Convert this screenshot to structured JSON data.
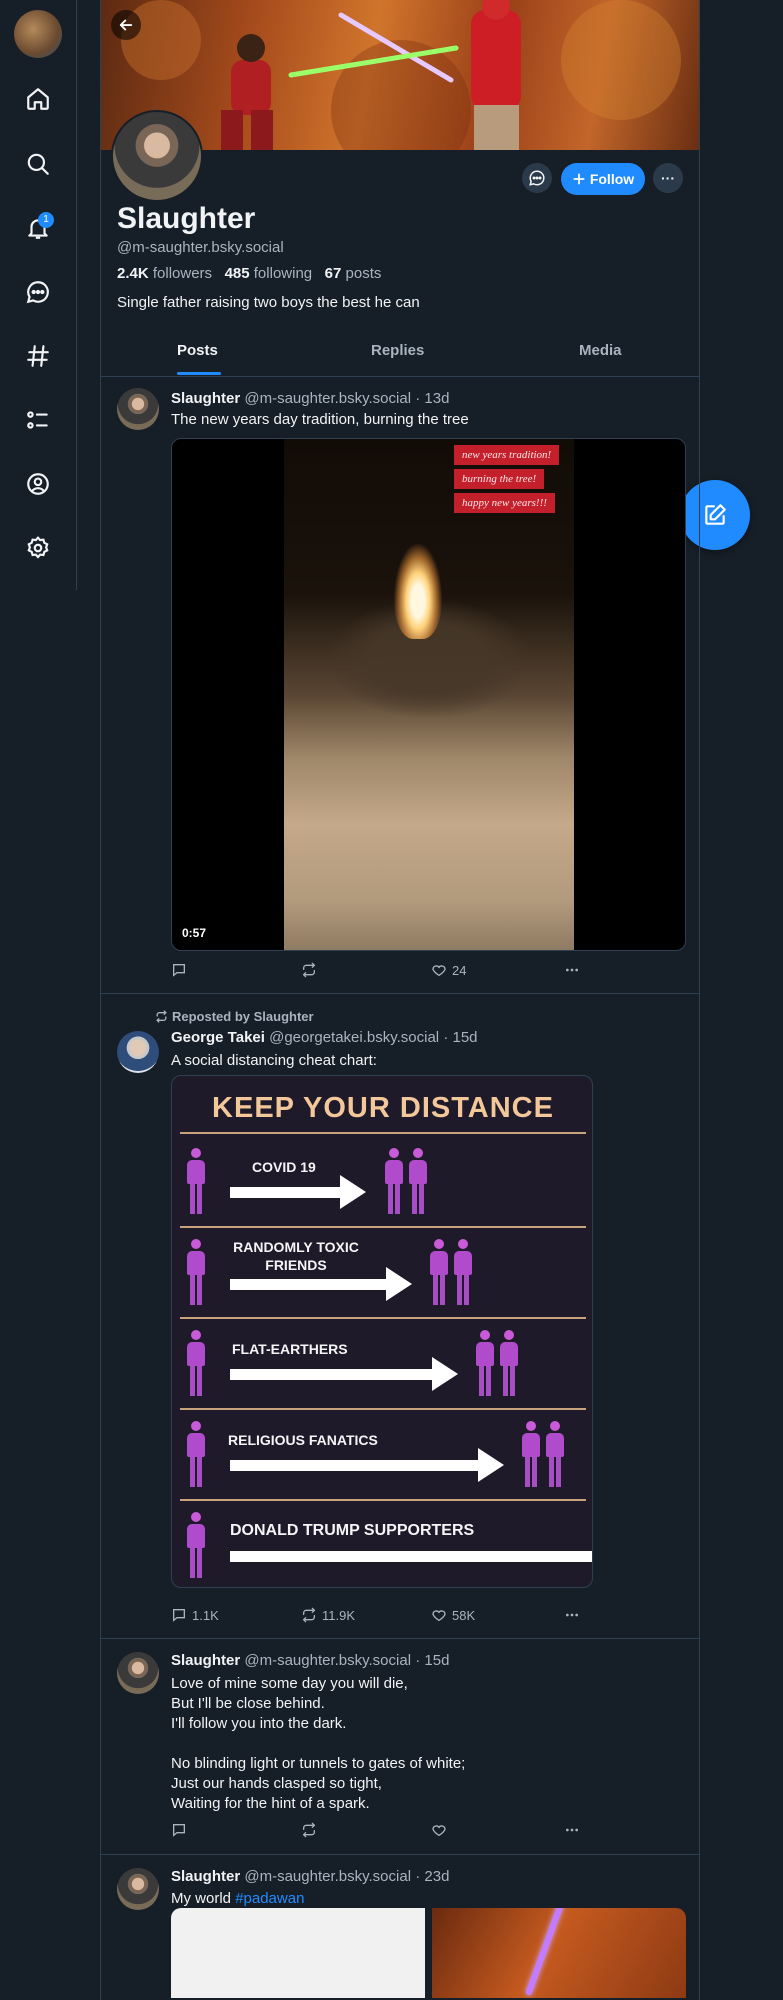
{
  "nav": {
    "notification_count": "1"
  },
  "profile": {
    "display_name": "Slaughter",
    "handle": "@m-saughter.bsky.social",
    "followers_count": "2.4K",
    "followers_label": "followers",
    "following_count": "485",
    "following_label": "following",
    "posts_count": "67",
    "posts_label": "posts",
    "bio": "Single father raising two boys the best he can",
    "follow_label": "Follow",
    "more_label": "···"
  },
  "tabs": [
    "Posts",
    "Replies",
    "Media"
  ],
  "active_tab": "Posts",
  "posts": [
    {
      "author": "Slaughter",
      "handle": "@m-saughter.bsky.social",
      "age": "13d",
      "text": "The new years day tradition, burning the tree",
      "video": {
        "duration": "0:57",
        "captions": [
          "new years tradition!",
          "burning the tree!",
          "happy new years!!!"
        ]
      },
      "replies": "",
      "reposts": "",
      "likes": "24"
    },
    {
      "repost_label": "Reposted by Slaughter",
      "author": "George Takei",
      "handle": "@georgetakei.bsky.social",
      "age": "15d",
      "text": "A social distancing cheat chart:",
      "image": {
        "title": "KEEP YOUR DISTANCE",
        "rows": [
          "COVID 19",
          "RANDOMLY TOXIC FRIENDS",
          "FLAT-EARTHERS",
          "RELIGIOUS FANATICS",
          "DONALD TRUMP SUPPORTERS"
        ]
      },
      "replies": "1.1K",
      "reposts": "11.9K",
      "likes": "58K"
    },
    {
      "author": "Slaughter",
      "handle": "@m-saughter.bsky.social",
      "age": "15d",
      "text": "Love of mine some day you will die,\nBut I'll be close behind.\nI'll follow you into the dark.\n\nNo blinding light or tunnels to gates of white;\nJust our hands clasped so tight,\nWaiting for the hint of a spark.",
      "replies": "",
      "reposts": "",
      "likes": ""
    },
    {
      "author": "Slaughter",
      "handle": "@m-saughter.bsky.social",
      "age": "23d",
      "text": "My world",
      "hashtag": "#padawan"
    }
  ],
  "colors": {
    "background": "#161e27",
    "accent": "#208bfe",
    "border": "#2e4052",
    "muted_text": "#a8b4c0"
  }
}
